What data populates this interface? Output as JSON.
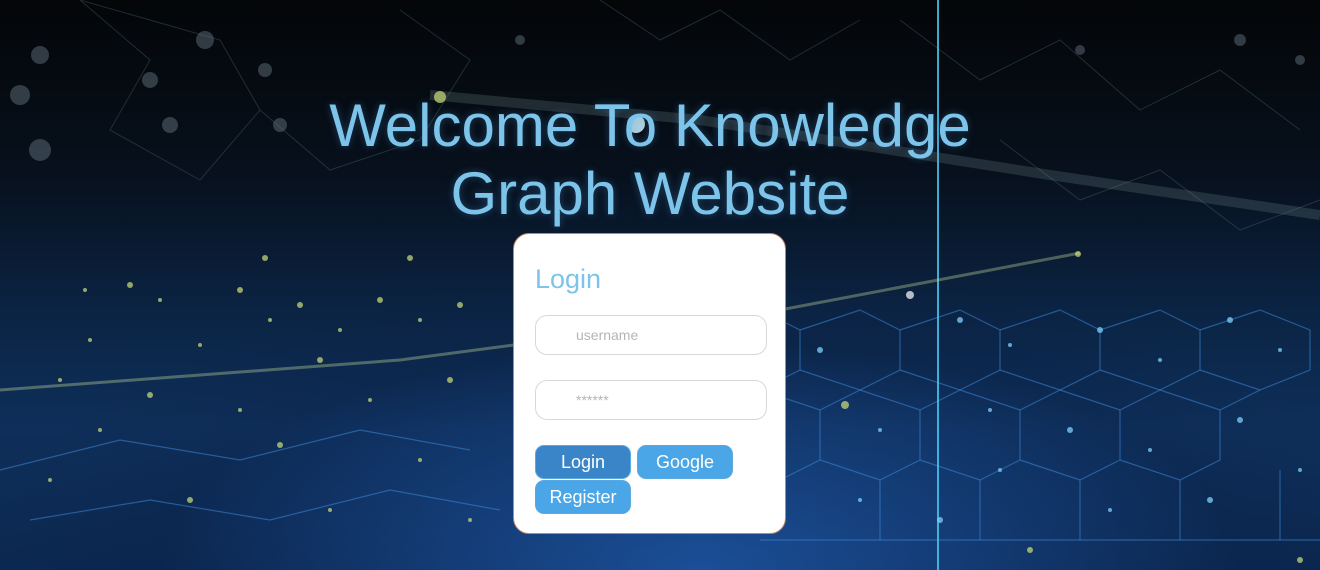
{
  "page": {
    "title": "Welcome To Knowledge Graph Website"
  },
  "login_form": {
    "heading": "Login",
    "username_placeholder": "username",
    "password_placeholder": "******",
    "login_label": "Login",
    "google_label": "Google",
    "register_label": "Register"
  },
  "colors": {
    "accent": "#7cc4ea",
    "button_primary": "#3a84c8",
    "button_secondary": "#4aa6e6",
    "card_border": "#c8865a"
  }
}
